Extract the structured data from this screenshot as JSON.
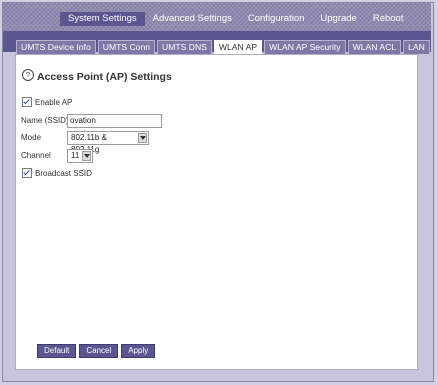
{
  "main_nav": [
    {
      "label": "System Settings",
      "active": true
    },
    {
      "label": "Advanced Settings",
      "active": false
    },
    {
      "label": "Configuration",
      "active": false
    },
    {
      "label": "Upgrade",
      "active": false
    },
    {
      "label": "Reboot",
      "active": false
    }
  ],
  "tabs": [
    {
      "label": "UMTS Device Info",
      "active": false
    },
    {
      "label": "UMTS Conn",
      "active": false
    },
    {
      "label": "UMTS DNS",
      "active": false
    },
    {
      "label": "WLAN AP",
      "active": true
    },
    {
      "label": "WLAN AP Security",
      "active": false
    },
    {
      "label": "WLAN ACL",
      "active": false
    },
    {
      "label": "LAN",
      "active": false
    }
  ],
  "page": {
    "help_icon": "question-circle-icon",
    "help_glyph": "?",
    "title": "Access Point (AP) Settings"
  },
  "form": {
    "enable_ap": {
      "label": "Enable AP",
      "checked": true
    },
    "ssid": {
      "label": "Name (SSID)",
      "value": "ovation"
    },
    "mode": {
      "label": "Mode",
      "value": "802.11b & 802.11g"
    },
    "channel": {
      "label": "Channel",
      "value": "11"
    },
    "broadcast_ssid": {
      "label": "Broadcast SSID",
      "checked": true
    }
  },
  "buttons": {
    "default": "Default",
    "cancel": "Cancel",
    "apply": "Apply"
  },
  "colors": {
    "header_bg": "#8f8bb2",
    "tab_bar_bg": "#5a5690",
    "button_bg": "#5a5690",
    "page_bg": "#d4d0e4"
  }
}
